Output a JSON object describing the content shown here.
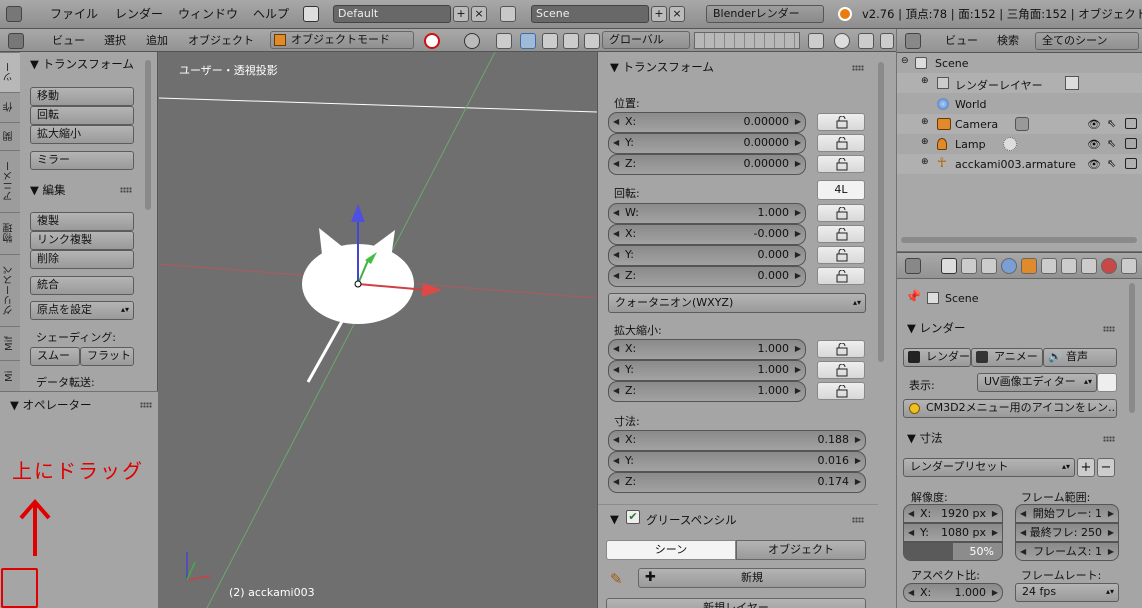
{
  "topbar": {
    "menus": [
      "ファイル",
      "レンダー",
      "ウィンドウ",
      "ヘルプ"
    ],
    "layout": "Default",
    "scene": "Scene",
    "engine": "Blenderレンダー",
    "stats": "v2.76 | 頂点:78 | 面:152 | 三角面:152 | オブジェクト:2/"
  },
  "view3d_header": {
    "menus": [
      "ビュー",
      "選択",
      "追加",
      "オブジェクト"
    ],
    "mode": "オブジェクトモード",
    "orientation": "グローバル"
  },
  "toolshelf": {
    "tabs": [
      "ツー",
      "作",
      "関",
      "アニメー",
      "物理",
      "グリースペ",
      "Mif",
      "Mi"
    ],
    "transform_title": "トランスフォーム",
    "move": "移動",
    "rotate": "回転",
    "scale": "拡大縮小",
    "mirror": "ミラー",
    "edit_title": "編集",
    "duplicate": "複製",
    "link_duplicate": "リンク複製",
    "delete": "削除",
    "join": "統合",
    "set_origin": "原点を設定",
    "shading_label": "シェーディング:",
    "smooth": "スムー",
    "flat": "フラット",
    "data_transfer": "データ転送:",
    "operator_title": "オペレーター"
  },
  "annotation": {
    "text": "上にドラッグ",
    "color": "#e00000"
  },
  "viewport": {
    "view_label": "ユーザー・透視投影",
    "object_label": "(2) acckami003"
  },
  "npanel": {
    "transform_title": "トランスフォーム",
    "location_label": "位置:",
    "location": [
      {
        "axis": "X:",
        "value": "0.00000"
      },
      {
        "axis": "Y:",
        "value": "0.00000"
      },
      {
        "axis": "Z:",
        "value": "0.00000"
      }
    ],
    "rotation_label": "回転:",
    "rotation_4l": "4L",
    "rotation": [
      {
        "axis": "W:",
        "value": "1.000"
      },
      {
        "axis": "X:",
        "value": "-0.000"
      },
      {
        "axis": "Y:",
        "value": "0.000"
      },
      {
        "axis": "Z:",
        "value": "0.000"
      }
    ],
    "rotation_mode": "クォータニオン(WXYZ)",
    "scale_label": "拡大縮小:",
    "scale": [
      {
        "axis": "X:",
        "value": "1.000"
      },
      {
        "axis": "Y:",
        "value": "1.000"
      },
      {
        "axis": "Z:",
        "value": "1.000"
      }
    ],
    "dimensions_label": "寸法:",
    "dimensions": [
      {
        "axis": "X:",
        "value": "0.188"
      },
      {
        "axis": "Y:",
        "value": "0.016"
      },
      {
        "axis": "Z:",
        "value": "0.174"
      }
    ],
    "grease_title": "グリースペンシル",
    "tab_scene": "シーン",
    "tab_object": "オブジェクト",
    "new_label": "新規",
    "new_layer": "新規レイヤー"
  },
  "outliner": {
    "view": "ビュー",
    "search": "検索",
    "filter": "全てのシーン",
    "items": [
      {
        "label": "Scene"
      },
      {
        "label": "レンダーレイヤー"
      },
      {
        "label": "World"
      },
      {
        "label": "Camera"
      },
      {
        "label": "Lamp"
      },
      {
        "label": "acckami003.armature"
      }
    ]
  },
  "properties": {
    "scene": "Scene",
    "render_title": "レンダー",
    "render_btn": "レンダー",
    "anim_btn": "アニメー",
    "audio_btn": "音声",
    "display_label": "表示:",
    "display_value": "UV画像エディター",
    "cm3d2": "CM3D2メニュー用のアイコンをレン...",
    "dimensions_title": "寸法",
    "preset": "レンダープリセット",
    "resolution_label": "解像度:",
    "res_x_axis": "X:",
    "res_x": "1920 px",
    "res_y_axis": "Y:",
    "res_y": "1080 px",
    "res_pct": "50%",
    "res_pct_fraction": 0.5,
    "frame_range_label": "フレーム範囲:",
    "frame_start": "開始フレー: 1",
    "frame_end": "最終フレ: 250",
    "frame_step": "フレームス: 1",
    "aspect_label": "アスペクト比:",
    "aspect_axis": "X:",
    "aspect_x": "1.000",
    "framerate_label": "フレームレート:",
    "framerate": "24 fps"
  }
}
